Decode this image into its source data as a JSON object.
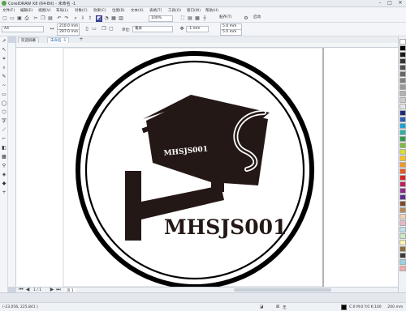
{
  "window": {
    "title": "CorelDRAW X8 (64-Bit) - 未命名 -1"
  },
  "menu": [
    "文件(F)",
    "编辑(E)",
    "视图(V)",
    "布局(L)",
    "对象(C)",
    "效果(C)",
    "位图(B)",
    "文本(X)",
    "表格(T)",
    "工具(O)",
    "窗口(W)",
    "帮助(H)"
  ],
  "toolbar": {
    "zoom": "100%",
    "snap_label": "贴齐(T)",
    "launch_label": "启动"
  },
  "property_bar": {
    "page_preset": "A4",
    "width": "210.0 mm",
    "height": "297.0 mm",
    "units_label": "单位:",
    "units": "毫米",
    "nudge": ".1 mm",
    "dup_x": "5.0 mm",
    "dup_y": "5.0 mm"
  },
  "tabs": [
    "欢迎屏幕",
    "未命名 -1"
  ],
  "artwork": {
    "camera_text": "MHSJS001",
    "main_text": "MHSJS001"
  },
  "page_nav": {
    "page_label": "页 1",
    "counter": "1 / 1"
  },
  "status": {
    "coords": "(-23.056, 225.841 )",
    "fill_none": "无",
    "color_model": "C:0 M:0 Y:0 K:100",
    "stroke_width": ".200 mm"
  },
  "palette_colors": [
    "#ffffff",
    "#000000",
    "#1a1a1a",
    "#333333",
    "#4d4d4d",
    "#666666",
    "#808080",
    "#999999",
    "#b3b3b3",
    "#cccccc",
    "#e6e6e6",
    "#1e2a78",
    "#2b5fb8",
    "#1da1d8",
    "#2bb3a4",
    "#2f9a48",
    "#7cbd3a",
    "#d7e02a",
    "#f6c21c",
    "#f39a1e",
    "#e8571e",
    "#d8241f",
    "#c41d5b",
    "#8e2a8c",
    "#5b2d8e",
    "#7a4b2a",
    "#b48a5a",
    "#f2d2b6",
    "#e6b8c8",
    "#bfe0f0",
    "#c9e8c4",
    "#fff3b0",
    "#8a6d3b",
    "#3c3c3c",
    "#9ad1e8",
    "#f7a8a8"
  ]
}
